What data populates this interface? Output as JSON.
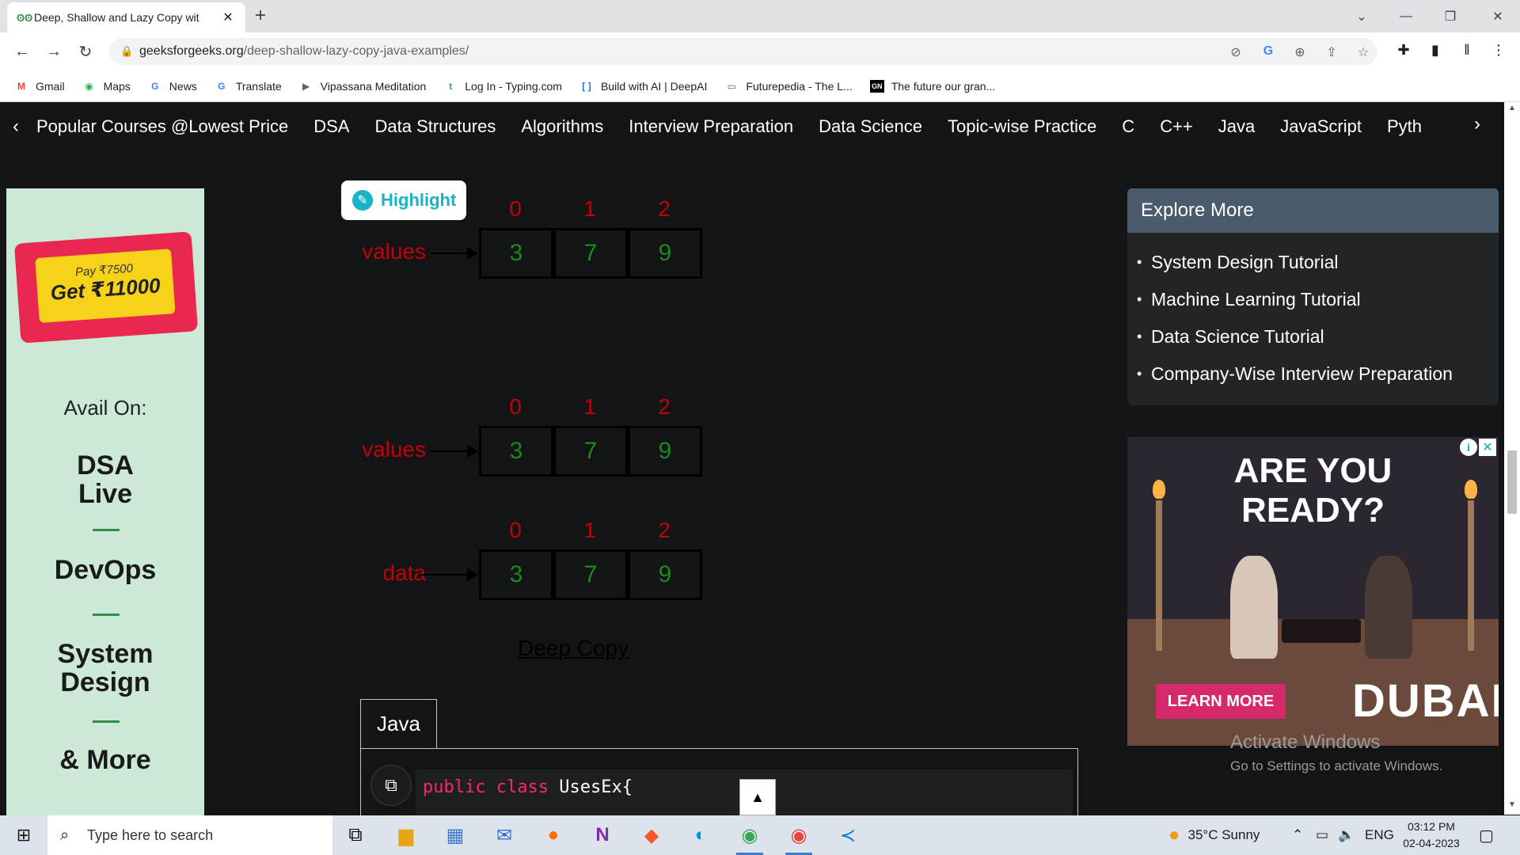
{
  "browser": {
    "tab": {
      "title": "Deep, Shallow and Lazy Copy wit",
      "favicon": "gfg-icon"
    },
    "url_host": "geeksforgeeks.org",
    "url_path": "/deep-shallow-lazy-copy-java-examples/",
    "bookmarks": [
      {
        "label": "Gmail",
        "icon": "gmail-icon",
        "color": "#ea4335"
      },
      {
        "label": "Maps",
        "icon": "maps-icon",
        "color": "#34a853"
      },
      {
        "label": "News",
        "icon": "news-icon",
        "color": "#4285f4"
      },
      {
        "label": "Translate",
        "icon": "translate-icon",
        "color": "#4285f4"
      },
      {
        "label": "Vipassana Meditation",
        "icon": "vipassana-icon",
        "color": "#5f6368"
      },
      {
        "label": "Log In - Typing.com",
        "icon": "typing-icon",
        "color": "#3c8dbc"
      },
      {
        "label": "Build with AI | DeepAI",
        "icon": "deepai-icon",
        "color": "#1a73e8"
      },
      {
        "label": "Futurepedia - The L...",
        "icon": "futurepedia-icon",
        "color": "#5f6368"
      },
      {
        "label": "The future our gran...",
        "icon": "gn-icon",
        "color": "#000000"
      }
    ]
  },
  "gfg_nav": {
    "items": [
      "Popular Courses @Lowest Price",
      "DSA",
      "Data Structures",
      "Algorithms",
      "Interview Preparation",
      "Data Science",
      "Topic-wise Practice",
      "C",
      "C++",
      "Java",
      "JavaScript",
      "Pyth"
    ]
  },
  "left_ad": {
    "pay": "Pay ₹7500",
    "get": "Get ₹11000",
    "avail": "Avail On:",
    "items": [
      "DSA\nLive",
      "DevOps",
      "System\nDesign",
      "& More"
    ]
  },
  "highlight_button": {
    "label": "Highlight"
  },
  "diagram": {
    "indices": [
      "0",
      "1",
      "2"
    ],
    "arrays": [
      {
        "label": "values",
        "cells": [
          "3",
          "7",
          "9"
        ]
      },
      {
        "label": "values",
        "cells": [
          "3",
          "7",
          "9"
        ]
      },
      {
        "label": "data",
        "cells": [
          "3",
          "7",
          "9"
        ]
      }
    ],
    "caption": "Deep Copy"
  },
  "code": {
    "language_tab": "Java",
    "line1_kw1": "public",
    "line1_kw2": "class",
    "line1_rest": "UsesEx{"
  },
  "explore": {
    "title": "Explore More",
    "items": [
      "System Design Tutorial",
      "Machine Learning Tutorial",
      "Data Science Tutorial",
      "Company-Wise Interview Preparation"
    ]
  },
  "right_ad": {
    "headline_line1": "ARE YOU",
    "headline_line2": "READY?",
    "cta": "LEARN MORE",
    "brand": "DUBAI"
  },
  "activation": {
    "title": "Activate Windows",
    "subtitle": "Go to Settings to activate Windows."
  },
  "taskbar": {
    "search_placeholder": "Type here to search",
    "weather": "35°C  Sunny",
    "language": "ENG",
    "time": "03:12 PM",
    "date": "02-04-2023"
  }
}
